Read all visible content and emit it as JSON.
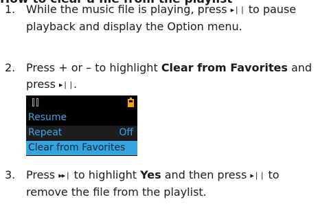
{
  "heading": "How to clear a file from the playlist",
  "steps": [
    {
      "number": "1.",
      "text_a": "While the music file is playing, press",
      "text_b": "to pause playback and display the Option menu."
    },
    {
      "number": "2.",
      "text_a": "Press + or – to highlight",
      "bold": "Clear from Favorites",
      "text_b": "and press",
      "text_c": "."
    },
    {
      "number": "3.",
      "text_a": "Press",
      "text_b": "to highlight",
      "bold": "Yes",
      "text_c": "and then press",
      "text_d": "to remove the file from the playlist."
    }
  ],
  "symbols": {
    "play_pause": "▸❘❘",
    "next": "▸▸❘"
  },
  "device": {
    "status_icons": [
      "pause-icon",
      "battery-icon"
    ],
    "menu_items": [
      {
        "label": "Resume",
        "value": ""
      },
      {
        "label": "Repeat",
        "value": "Off"
      },
      {
        "label": "Clear from Favorites",
        "value": ""
      }
    ],
    "colors": {
      "background": "#000000",
      "text": "#3ea6e4",
      "highlight": "#33a6e2",
      "status_icon": "#f5a300"
    }
  }
}
